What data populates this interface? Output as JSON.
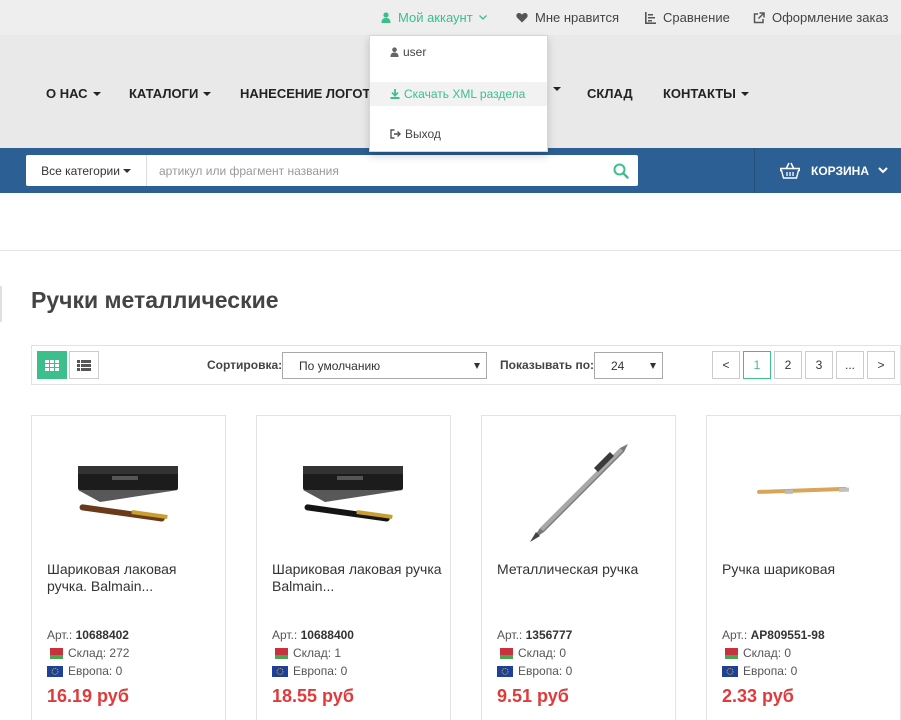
{
  "topbar": {
    "account": "Мой аккаунт",
    "likes": "Мне нравится",
    "compare": "Сравнение",
    "order": "Оформление заказ"
  },
  "dropdown": {
    "user": "user",
    "download_xml": "Скачать XML раздела",
    "logout": "Выход"
  },
  "nav": {
    "about": "О НАС",
    "catalogs": "КАТАЛОГИ",
    "logo": "НАНЕСЕНИЕ ЛОГОТИ",
    "warehouse": "СКЛАД",
    "contacts": "КОНТАКТЫ"
  },
  "search": {
    "category": "Все категории",
    "placeholder": "артикул или фрагмент названия"
  },
  "cart": {
    "label": "КОРЗИНА"
  },
  "page": {
    "title": "Ручки металлические"
  },
  "toolbar": {
    "sort_label": "Сортировка:",
    "sort_value": "По умолчанию",
    "count_label": "Показывать по:",
    "count_value": "24",
    "pages": [
      "<",
      "1",
      "2",
      "3",
      "...",
      ">"
    ]
  },
  "products": [
    {
      "name": "Шариковая лаковая ручка. Balmain...",
      "art_label": "Арт.:",
      "art": "10688402",
      "stock_by": "Склад: 272",
      "stock_eu": "Европа: 0",
      "price": "16.19 руб"
    },
    {
      "name": "Шариковая лаковая ручка Balmain...",
      "art_label": "Арт.:",
      "art": "10688400",
      "stock_by": "Склад: 1",
      "stock_eu": "Европа: 0",
      "price": "18.55 руб"
    },
    {
      "name": "Металлическая ручка",
      "art_label": "Арт.:",
      "art": "1356777",
      "stock_by": "Склад: 0",
      "stock_eu": "Европа: 0",
      "price": "9.51 руб"
    },
    {
      "name": "Ручка шариковая",
      "art_label": "Арт.:",
      "art": "AP809551-98",
      "stock_by": "Склад: 0",
      "stock_eu": "Европа: 0",
      "price": "2.33 руб"
    }
  ],
  "colors": {
    "accent": "#3cbf8b",
    "header_blue": "#2c5f93",
    "price_red": "#e03a3a"
  }
}
